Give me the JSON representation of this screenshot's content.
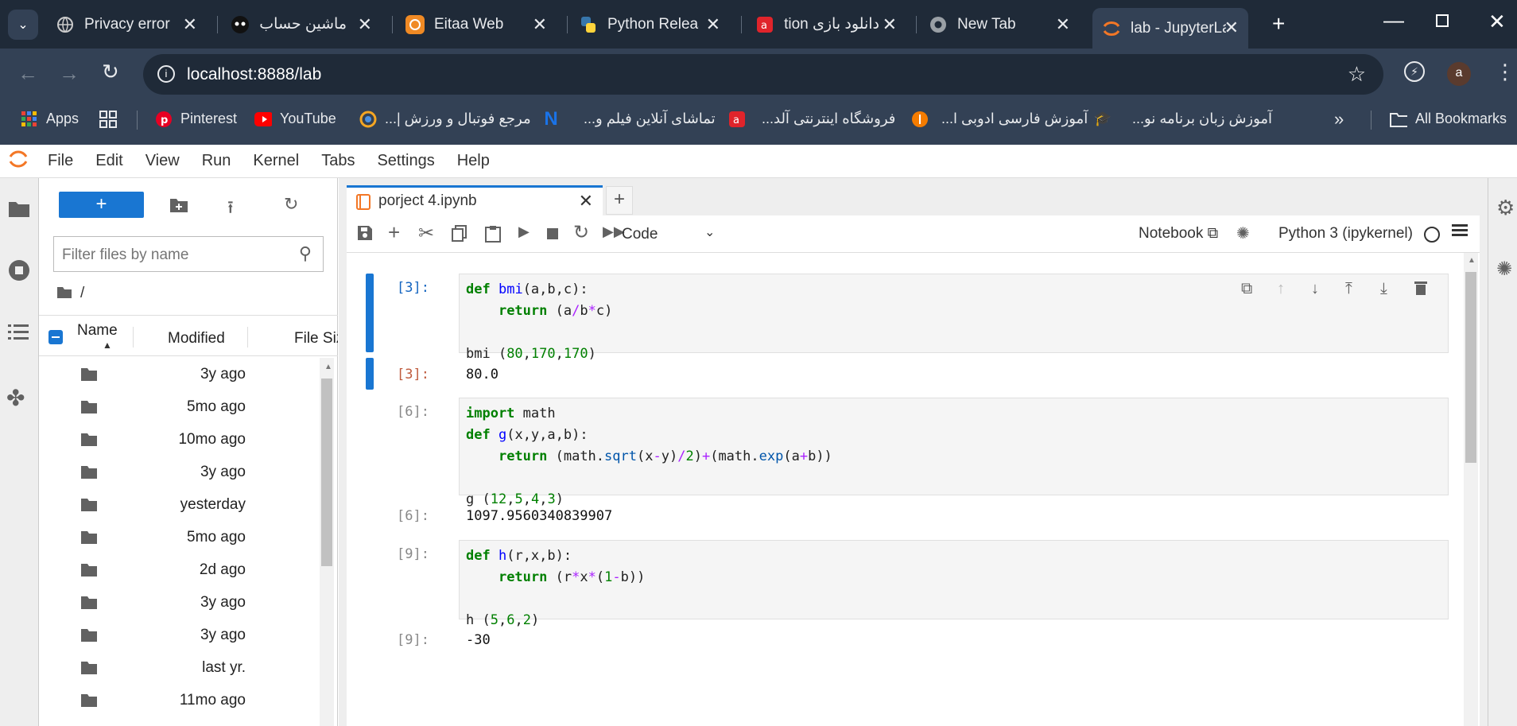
{
  "browser_tabs": [
    {
      "title": "Privacy error",
      "icon": "globe-icon"
    },
    {
      "title": "ماشین حساب -",
      "icon": "robot-icon"
    },
    {
      "title": "Eitaa Web",
      "icon": "eitaa-icon"
    },
    {
      "title": "Python Releas",
      "icon": "python-icon"
    },
    {
      "title": "دانلود بازی tion",
      "icon": "a-red-icon"
    },
    {
      "title": "New Tab",
      "icon": "chrome-icon"
    },
    {
      "title": "lab - JupyterLa",
      "icon": "jupyter-icon"
    }
  ],
  "address": {
    "url": "localhost:8888/lab",
    "avatar": "a"
  },
  "bookmarks": [
    {
      "label": "Apps"
    },
    {
      "label": ""
    },
    {
      "label": "Pinterest"
    },
    {
      "label": "YouTube"
    },
    {
      "label": "مرجع فوتبال و ورزش |..."
    },
    {
      "label": "تماشای آنلاین فیلم و..."
    },
    {
      "label": "فروشگاه اینترنتی آلد..."
    },
    {
      "label": "آموزش فارسی ادوبی ا..."
    },
    {
      "label": "آموزش زبان برنامه نو..."
    },
    {
      "label": "All Bookmarks"
    }
  ],
  "menu": [
    "File",
    "Edit",
    "View",
    "Run",
    "Kernel",
    "Tabs",
    "Settings",
    "Help"
  ],
  "filebrowser": {
    "new_label": "+",
    "filter_placeholder": "Filter files by name",
    "path": "/",
    "col_name": "Name",
    "col_modified": "Modified",
    "col_size": "File Siz",
    "rows": [
      "3y ago",
      "5mo ago",
      "10mo ago",
      "3y ago",
      "yesterday",
      "5mo ago",
      "2d ago",
      "3y ago",
      "3y ago",
      "last yr.",
      "11mo ago"
    ]
  },
  "notebook": {
    "tab_title": "porject 4.ipynb",
    "cell_type": "Code",
    "notebook_label": "Notebook",
    "kernel": "Python 3 (ipykernel)",
    "cells": [
      {
        "prompt": "[3]:",
        "out_prompt": "[3]:",
        "output": "80.0"
      },
      {
        "prompt": "[6]:",
        "out_prompt": "[6]:",
        "output": "1097.9560340839907"
      },
      {
        "prompt": "[9]:",
        "out_prompt": "[9]:",
        "output": "-30"
      }
    ]
  }
}
